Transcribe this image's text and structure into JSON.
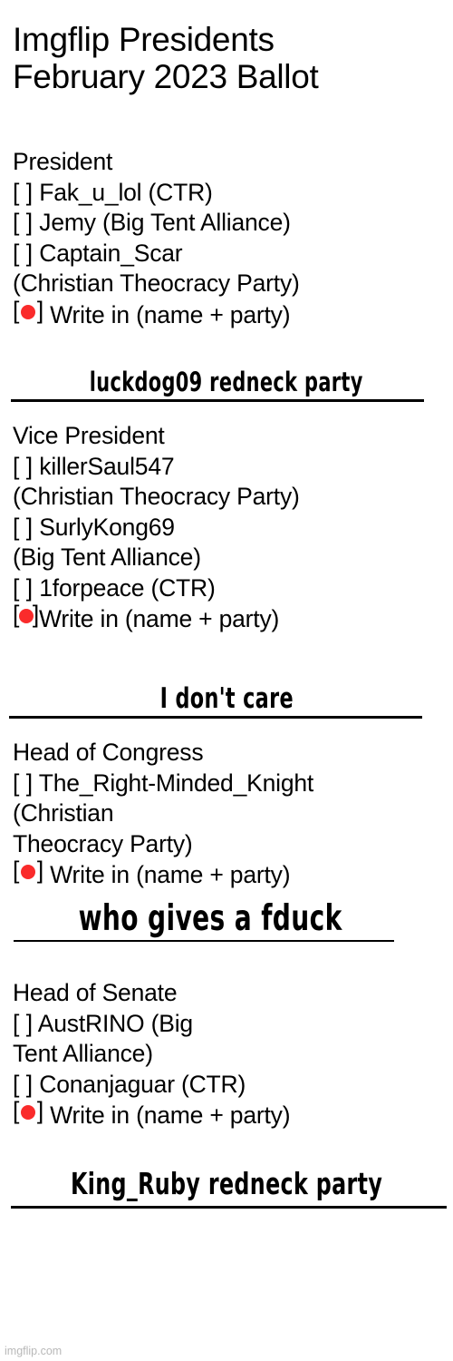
{
  "header": {
    "title_line_1": "Imgflip Presidents",
    "title_line_2": "February 2023 Ballot"
  },
  "marker": {
    "empty_box": "[  ]",
    "bracket_left": "[",
    "bracket_right": "]",
    "selected_color": "#fa2b2b",
    "selected_icon": "red-filled-circle"
  },
  "races": [
    {
      "id": "president",
      "heading": "President",
      "options": [
        {
          "label": "Fak_u_lol (CTR)",
          "selected": false
        },
        {
          "label": "Jemy (Big Tent Alliance)",
          "selected": false
        },
        {
          "label": "Captain_Scar",
          "selected": false
        },
        {
          "label": "(Christian Theocracy Party)",
          "selected": false,
          "continuation": true
        },
        {
          "label": "Write in (name + party)",
          "selected": true
        }
      ],
      "write_in_value": "luckdog09 redneck party"
    },
    {
      "id": "vice-president",
      "heading": "Vice President",
      "options": [
        {
          "label": "killerSaul547",
          "selected": false
        },
        {
          "label": "(Christian Theocracy Party)",
          "selected": false,
          "continuation": true
        },
        {
          "label": "SurlyKong69",
          "selected": false
        },
        {
          "label": "(Big Tent Alliance)",
          "selected": false,
          "continuation": true
        },
        {
          "label": "1forpeace (CTR)",
          "selected": false
        },
        {
          "label": "Write in (name + party)",
          "selected": true
        }
      ],
      "write_in_value": "I don't care"
    },
    {
      "id": "head-of-congress",
      "heading": "Head of Congress",
      "options": [
        {
          "label": "The_Right-Minded_Knight",
          "selected": false
        },
        {
          "label": "(Christian",
          "selected": false,
          "continuation": true
        },
        {
          "label": "Theocracy Party)",
          "selected": false,
          "continuation": true
        },
        {
          "label": "Write in (name + party)",
          "selected": true
        }
      ],
      "write_in_value": "who gives a fduck"
    },
    {
      "id": "head-of-senate",
      "heading": "Head of Senate",
      "options": [
        {
          "label": "AustRINO (Big",
          "selected": false
        },
        {
          "label": "Tent Alliance)",
          "selected": false,
          "continuation": true
        },
        {
          "label": "Conanjaguar (CTR)",
          "selected": false
        },
        {
          "label": "Write in (name + party)",
          "selected": true
        }
      ],
      "write_in_value": "King_Ruby redneck party"
    }
  ],
  "footer": {
    "watermark": "imgflip.com"
  }
}
